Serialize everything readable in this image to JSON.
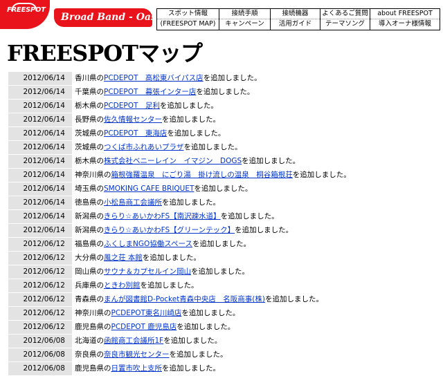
{
  "header": {
    "logo_text": "FREESPOT",
    "brand": "Broad Band - Oasis",
    "nav": [
      [
        "スポット情報",
        "(FREESPOT MAP)"
      ],
      [
        "接続手順",
        "キャンペーン"
      ],
      [
        "接続機器",
        "活用ガイド"
      ],
      [
        "よくあるご質問",
        "テーマソング"
      ],
      [
        "about FREESPOT",
        "導入オーナ様情報"
      ]
    ]
  },
  "page_title": "FREESPOTマップ",
  "suffix": "を追加しました。",
  "entries": [
    {
      "date": "2012/06/14",
      "pref": "香川県の",
      "link": "PCDEPOT　高松東バイパス店"
    },
    {
      "date": "2012/06/14",
      "pref": "千葉県の",
      "link": "PCDEPOT　幕張インター店"
    },
    {
      "date": "2012/06/14",
      "pref": "栃木県の",
      "link": "PCDEPOT　足利"
    },
    {
      "date": "2012/06/14",
      "pref": "長野県の",
      "link": "佐久情報センター"
    },
    {
      "date": "2012/06/14",
      "pref": "茨城県の",
      "link": "PCDEPOT　東海店"
    },
    {
      "date": "2012/06/14",
      "pref": "茨城県の",
      "link": "つくば市ふれあいプラザ"
    },
    {
      "date": "2012/06/14",
      "pref": "栃木県の",
      "link": "株式会社ベニーレイン　イマジン　DOGS"
    },
    {
      "date": "2012/06/14",
      "pref": "神奈川県の",
      "link": "箱根強羅温泉　にごり湯　掛け流しの温泉　桐谷箱根荘"
    },
    {
      "date": "2012/06/14",
      "pref": "埼玉県の",
      "link": "SMOKING CAFE BRIQUET"
    },
    {
      "date": "2012/06/14",
      "pref": "徳島県の",
      "link": "小松島商工会議所"
    },
    {
      "date": "2012/06/14",
      "pref": "新潟県の",
      "link": "きらり☆あいかわFS【南沢疎水道】"
    },
    {
      "date": "2012/06/14",
      "pref": "新潟県の",
      "link": "きらり☆あいかわFS【グリーンテック】"
    },
    {
      "date": "2012/06/12",
      "pref": "福島県の",
      "link": "ふくしまNGO協働スペース"
    },
    {
      "date": "2012/06/12",
      "pref": "大分県の",
      "link": "風之荘 本館"
    },
    {
      "date": "2012/06/12",
      "pref": "岡山県の",
      "link": "サウナ＆カプセルイン岡山"
    },
    {
      "date": "2012/06/12",
      "pref": "兵庫県の",
      "link": "ときわ別館"
    },
    {
      "date": "2012/06/12",
      "pref": "青森県の",
      "link": "まんが図書館D-Pocket青森中央店　名阪商事(株)"
    },
    {
      "date": "2012/06/12",
      "pref": "神奈川県の",
      "link": "PCDEPOT東名川崎店"
    },
    {
      "date": "2012/06/12",
      "pref": "鹿児島県の",
      "link": "PCDEPOT 鹿児島店"
    },
    {
      "date": "2012/06/08",
      "pref": "北海道の",
      "link": "函館商工会議所1F"
    },
    {
      "date": "2012/06/08",
      "pref": "奈良県の",
      "link": "奈良市観光センター"
    },
    {
      "date": "2012/06/08",
      "pref": "鹿児島県の",
      "link": "日置市吹上支所"
    }
  ]
}
